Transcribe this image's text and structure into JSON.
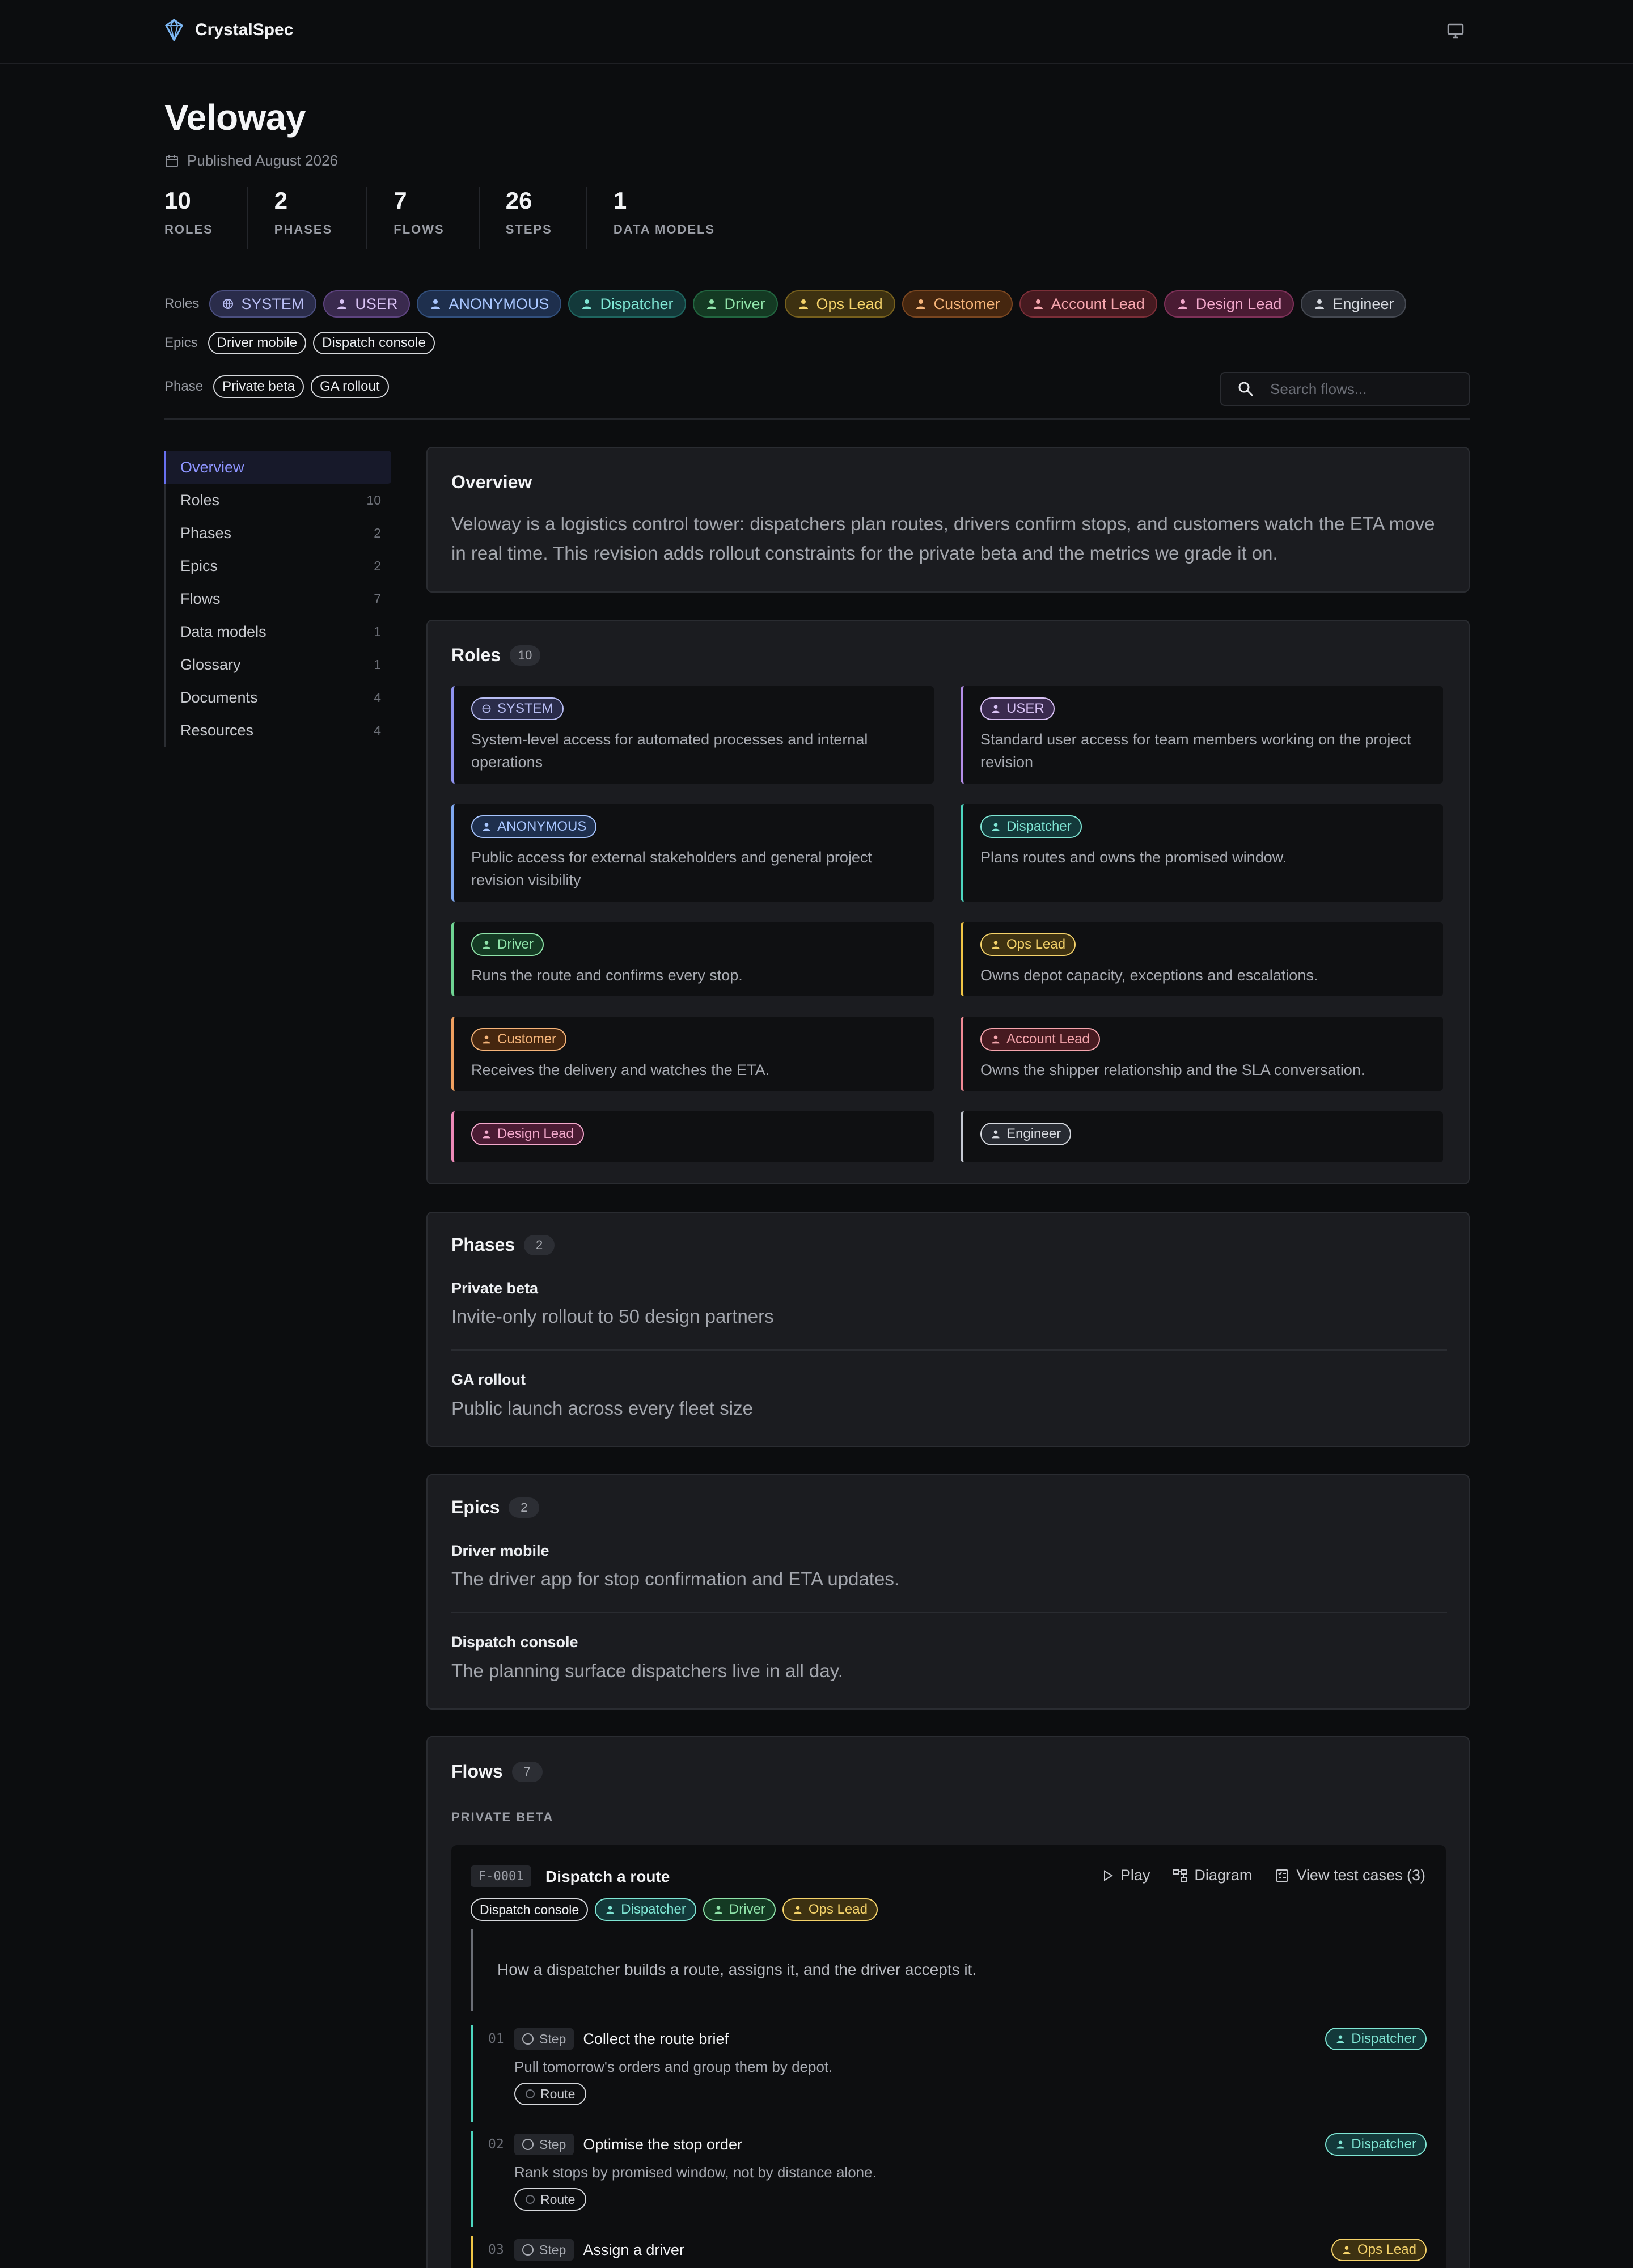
{
  "brand": {
    "name": "CrystalSpec"
  },
  "project": {
    "title": "Veloway",
    "published": "Published August 2026"
  },
  "stats": [
    {
      "num": "10",
      "label": "ROLES"
    },
    {
      "num": "2",
      "label": "PHASES"
    },
    {
      "num": "7",
      "label": "FLOWS"
    },
    {
      "num": "26",
      "label": "STEPS"
    },
    {
      "num": "1",
      "label": "DATA MODELS"
    }
  ],
  "filters": {
    "roles_label": "Roles",
    "roles": [
      "SYSTEM",
      "USER",
      "ANONYMOUS",
      "Dispatcher",
      "Driver",
      "Ops Lead",
      "Customer",
      "Account Lead",
      "Design Lead",
      "Engineer"
    ],
    "epics_label": "Epics",
    "epics": [
      "Driver mobile",
      "Dispatch console"
    ],
    "phase_label": "Phase",
    "phases": [
      "Private beta",
      "GA rollout"
    ]
  },
  "search": {
    "placeholder": "Search flows..."
  },
  "sidebar": [
    {
      "label": "Overview",
      "count": ""
    },
    {
      "label": "Roles",
      "count": "10"
    },
    {
      "label": "Phases",
      "count": "2"
    },
    {
      "label": "Epics",
      "count": "2"
    },
    {
      "label": "Flows",
      "count": "7"
    },
    {
      "label": "Data models",
      "count": "1"
    },
    {
      "label": "Glossary",
      "count": "1"
    },
    {
      "label": "Documents",
      "count": "4"
    },
    {
      "label": "Resources",
      "count": "4"
    }
  ],
  "overview": {
    "title": "Overview",
    "text": "Veloway is a logistics control tower: dispatchers plan routes, drivers confirm stops, and customers watch the ETA move in real time. This revision adds rollout constraints for the private beta and the metrics we grade it on."
  },
  "roles_section": {
    "title": "Roles",
    "count": "10",
    "cards": [
      {
        "name": "SYSTEM",
        "desc": "System-level access for automated processes and internal operations"
      },
      {
        "name": "USER",
        "desc": "Standard user access for team members working on the project revision"
      },
      {
        "name": "ANONYMOUS",
        "desc": "Public access for external stakeholders and general project revision visibility"
      },
      {
        "name": "Dispatcher",
        "desc": "Plans routes and owns the promised window."
      },
      {
        "name": "Driver",
        "desc": "Runs the route and confirms every stop."
      },
      {
        "name": "Ops Lead",
        "desc": "Owns depot capacity, exceptions and escalations."
      },
      {
        "name": "Customer",
        "desc": "Receives the delivery and watches the ETA."
      },
      {
        "name": "Account Lead",
        "desc": "Owns the shipper relationship and the SLA conversation."
      },
      {
        "name": "Design Lead",
        "desc": ""
      },
      {
        "name": "Engineer",
        "desc": ""
      }
    ]
  },
  "phases_section": {
    "title": "Phases",
    "count": "2",
    "items": [
      {
        "name": "Private beta",
        "desc": "Invite-only rollout to 50 design partners"
      },
      {
        "name": "GA rollout",
        "desc": "Public launch across every fleet size"
      }
    ]
  },
  "epics_section": {
    "title": "Epics",
    "count": "2",
    "items": [
      {
        "name": "Driver mobile",
        "desc": "The driver app for stop confirmation and ETA updates."
      },
      {
        "name": "Dispatch console",
        "desc": "The planning surface dispatchers live in all day."
      }
    ]
  },
  "flows_section": {
    "title": "Flows",
    "count": "7",
    "group_label": "PRIVATE BETA",
    "flow": {
      "id": "F-0001",
      "name": "Dispatch a route",
      "actions": {
        "play": "Play",
        "diagram": "Diagram",
        "tests": "View test cases (3)"
      },
      "epic": "Dispatch console",
      "roles": [
        "Dispatcher",
        "Driver",
        "Ops Lead"
      ],
      "summary": "How a dispatcher builds a route, assigns it, and the driver accepts it.",
      "steps": [
        {
          "num": "01",
          "type": "Step",
          "title": "Collect the route brief",
          "desc": "Pull tomorrow's orders and group them by depot.",
          "tag": "Route",
          "role": "Dispatcher"
        },
        {
          "num": "02",
          "type": "Step",
          "title": "Optimise the stop order",
          "desc": "Rank stops by promised window, not by distance alone.",
          "tag": "Route",
          "role": "Dispatcher"
        },
        {
          "num": "03",
          "type": "Step",
          "title": "Assign a driver",
          "desc": "",
          "tag": "",
          "role": "Ops Lead"
        }
      ]
    }
  },
  "colors": {
    "accent": "#6870f0",
    "background": "#0c0d0f",
    "card": "#1b1c20"
  }
}
